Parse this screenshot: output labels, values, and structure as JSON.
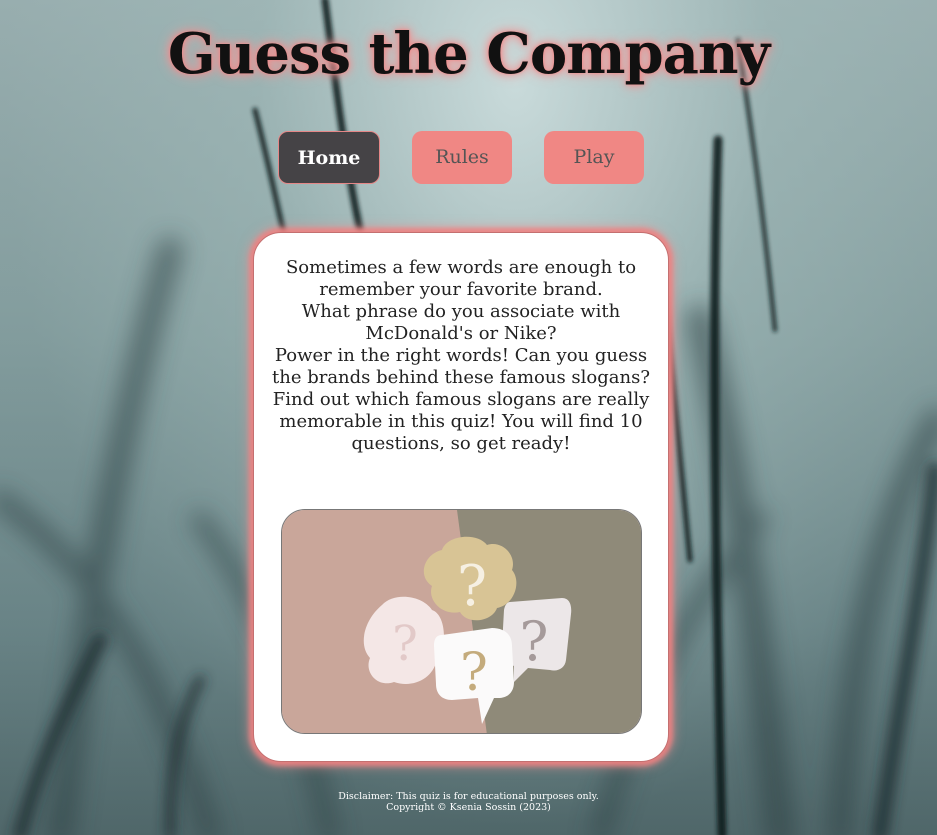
{
  "page": {
    "title": "Guess the Company"
  },
  "nav": {
    "items": [
      {
        "label": "Home",
        "active": true
      },
      {
        "label": "Rules",
        "active": false
      },
      {
        "label": "Play",
        "active": false
      }
    ]
  },
  "intro": {
    "paragraphs": [
      "Sometimes a few words are enough to remember your favorite brand.",
      "What phrase do you associate with McDonald's or Nike?",
      "Power in the right words! Can you guess the brands behind these famous slogans?",
      "Find out which famous slogans are really memorable in this quiz! You will find 10 questions, so get ready!"
    ]
  },
  "footer": {
    "disclaimer": "Disclaimer: This quiz is for educational purposes only.",
    "copyright": "Copyright © Ksenia Sossin (2023)"
  },
  "colors": {
    "accent": "#f08784",
    "active_nav": "#454346",
    "card_bg": "#ffffff"
  }
}
